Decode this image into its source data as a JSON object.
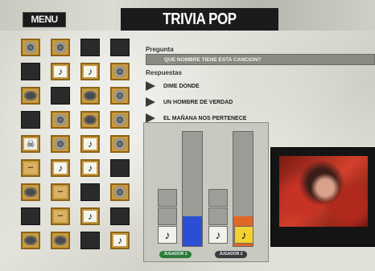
{
  "header": {
    "menu_label": "MENU",
    "title": "TRIVIA POP"
  },
  "question": {
    "label": "Pregunta",
    "text": "QUE NOMBRE TIENE ESTA CANCION?"
  },
  "answers": {
    "label": "Respuestas",
    "options": [
      "DIME DONDE",
      "UN HOMBRE DE VERDAD",
      "EL MAÑANA NOS PERTENECE"
    ]
  },
  "players": [
    {
      "label": "JUGADOR 1",
      "color": "#2b4fd3",
      "label_bg": "#2e7a3a",
      "level": 0.26
    },
    {
      "label": "JUGADOR 2",
      "color": "#e0662a",
      "label_bg": "#3a3a3a",
      "level": 0.26
    }
  ],
  "grid": {
    "rows": [
      [
        "disc",
        "disc",
        "dark",
        "dark"
      ],
      [
        "dark",
        "note",
        "note",
        "disc"
      ],
      [
        "eye",
        "dark",
        "eye",
        "disc"
      ],
      [
        "dark",
        "disc",
        "eye",
        "disc"
      ],
      [
        "skull",
        "disc",
        "note",
        "disc"
      ],
      [
        "label",
        "note",
        "note",
        "dark"
      ],
      [
        "eye",
        "label",
        "dark",
        "disc"
      ],
      [
        "dark",
        "label",
        "note",
        "dark"
      ],
      [
        "eye",
        "eye",
        "dark",
        "note"
      ]
    ]
  },
  "colors": {
    "accent_gold": "#c89a3c",
    "title_bg": "#1b1b1b"
  }
}
